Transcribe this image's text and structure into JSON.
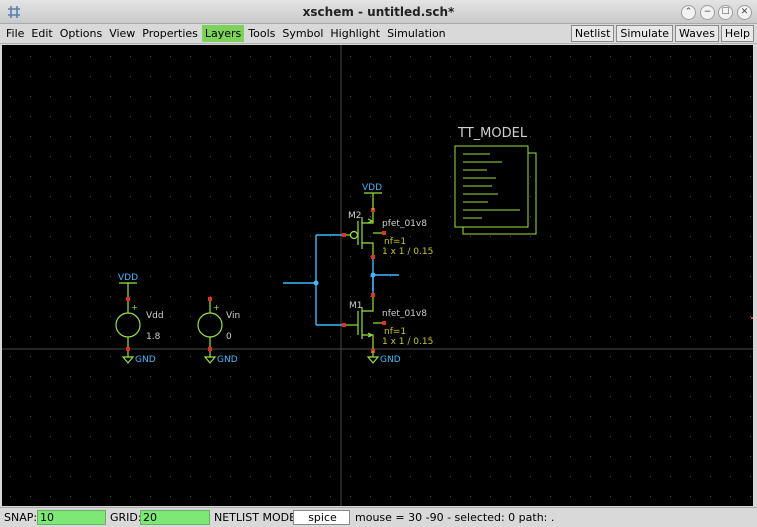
{
  "window": {
    "title": "xschem - untitled.sch*",
    "buttons": [
      "⌃",
      "−",
      "☐",
      "✕"
    ]
  },
  "menu": {
    "left": [
      "File",
      "Edit",
      "Options",
      "View",
      "Properties",
      "Layers",
      "Tools",
      "Symbol",
      "Highlight",
      "Simulation"
    ],
    "right": [
      "Netlist",
      "Simulate",
      "Waves",
      "Help"
    ]
  },
  "schematic": {
    "model_label": "TT_MODEL",
    "vdd_labels": [
      "VDD",
      "VDD"
    ],
    "gnd_labels": [
      "GND",
      "GND",
      "GND"
    ],
    "vdd_source": {
      "name": "Vdd",
      "value": "1.8"
    },
    "vin_source": {
      "name": "Vin",
      "value": "0"
    },
    "pmos": {
      "name": "M2",
      "model": "pfet_01v8",
      "nf": "nf=1",
      "size": "1 x 1 / 0.15"
    },
    "nmos": {
      "name": "M1",
      "model": "nfet_01v8",
      "nf": "nf=1",
      "size": "1 x 1 / 0.15"
    },
    "colors": {
      "wire": "#3fb8ff",
      "symbol": "#9ae23c",
      "pin": "#e0302a",
      "label": "#cccccc",
      "prop": "#c8c820",
      "grid": "#3c3c3c"
    }
  },
  "status": {
    "snap_label": "SNAP:",
    "snap_value": "10",
    "grid_label": "GRID:",
    "grid_value": "20",
    "netlist_label": "NETLIST MODE:",
    "netlist_value": "spice",
    "mouse_info": "mouse = 30 -90 - selected: 0 path: ."
  }
}
